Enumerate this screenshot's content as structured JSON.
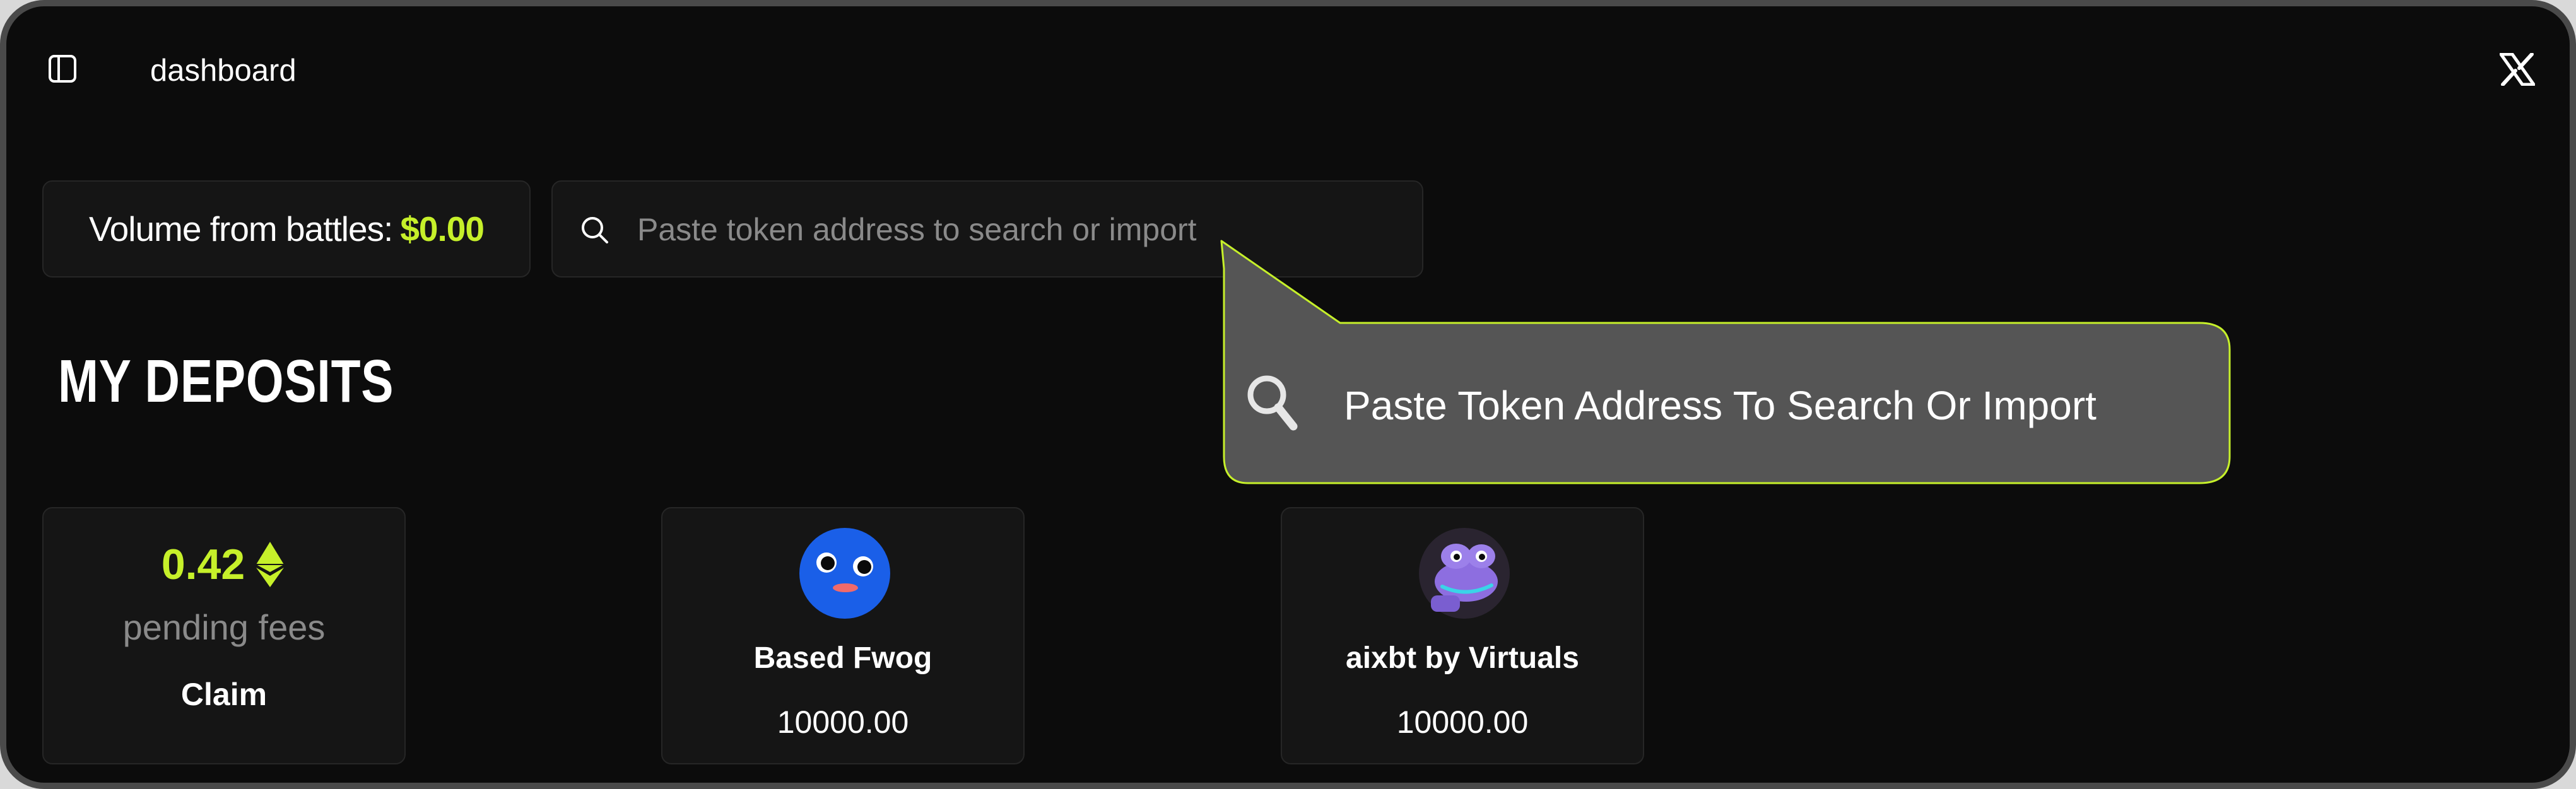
{
  "header": {
    "title": "dashboard",
    "sidebar_icon": "sidebar-panel-icon",
    "social_icon": "x-logo-icon"
  },
  "stats": {
    "volume_label": "Volume from battles:",
    "volume_value": "$0.00"
  },
  "search": {
    "placeholder": "Paste token address to search or import",
    "icon": "search-icon"
  },
  "tooltip": {
    "text": "Paste Token Address To Search Or Import",
    "icon": "magnifier-icon"
  },
  "deposits": {
    "heading": "MY DEPOSITS",
    "fees": {
      "value": "0.42",
      "icon": "ethereum-icon",
      "label": "pending fees",
      "claim_label": "Claim"
    },
    "tokens": [
      {
        "name": "Based Fwog",
        "amount": "10000.00",
        "avatar": "blue-frog-avatar"
      },
      {
        "name": "aixbt by Virtuals",
        "amount": "10000.00",
        "avatar": "purple-frog-avatar"
      }
    ]
  },
  "colors": {
    "background": "#0c0c0c",
    "accent": "#c6f02a",
    "card": "#151515",
    "tooltip": "#555555"
  }
}
